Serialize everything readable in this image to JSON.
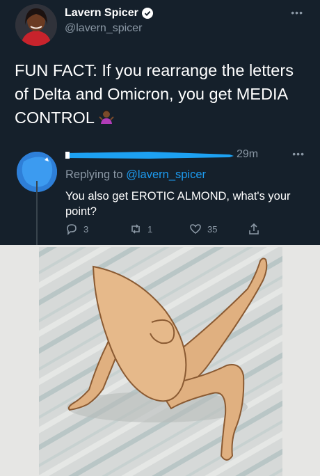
{
  "tweet": {
    "author_name": "Lavern Spicer",
    "handle": "@lavern_spicer",
    "text": "FUN FACT: If you rearrange the letters of Delta and Omicron, you get MEDIA CONTROL"
  },
  "reply": {
    "time": "29m",
    "replying_prefix": "Replying to ",
    "replying_to": "@lavern_spicer",
    "text": "You also get EROTIC ALMOND, what's your point?",
    "counts": {
      "replies": "3",
      "retweets": "1",
      "likes": "35"
    }
  },
  "icons": [
    "verified-icon",
    "more-icon",
    "reply-icon",
    "retweet-icon",
    "like-icon",
    "share-icon",
    "shrug-emoji"
  ],
  "colors": {
    "background": "#15202b",
    "secondary_text": "#8b98a5",
    "link": "#1d9bf0",
    "redaction": "#1da1f2"
  }
}
